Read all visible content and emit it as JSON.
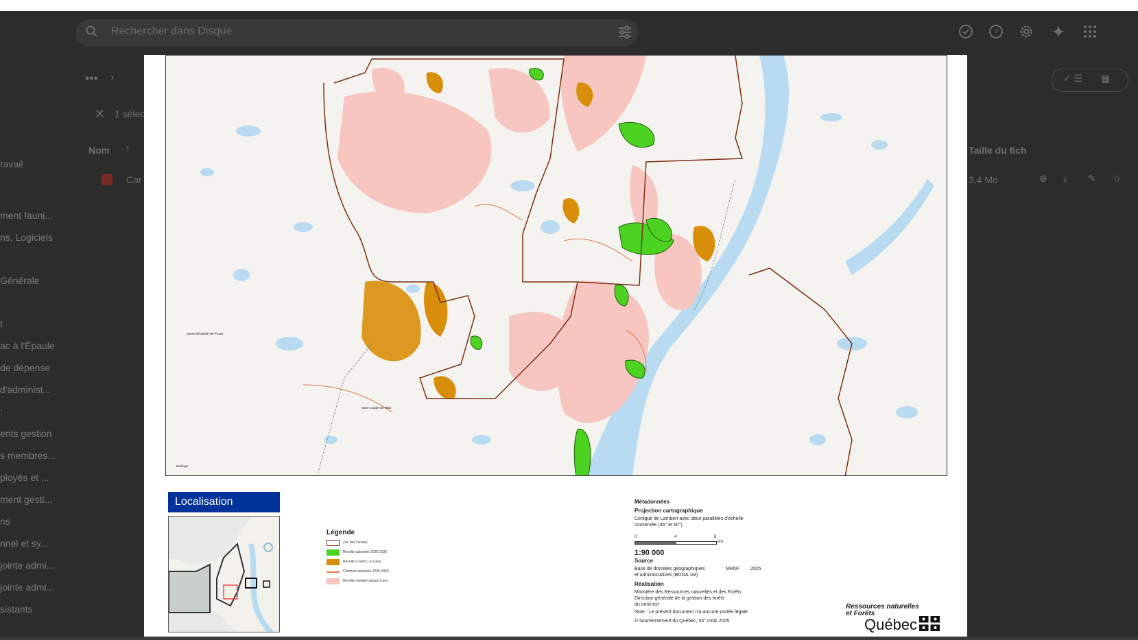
{
  "drive": {
    "search_placeholder": "Rechercher dans Disque",
    "selection_text": "1 sélec",
    "column_name": "Nom",
    "column_size": "Taille du fich",
    "file_name_fragment": "Car",
    "file_size": "3,4 Mo",
    "sidebar_items": [
      "ravail",
      "ment fauni...",
      "ns, Logiciels",
      "Générale",
      "t",
      "ac à l'Épaule",
      " de dépense",
      "d'administ...",
      ":",
      "ents gestion",
      "s membres...",
      "ployés et ...",
      "ment gesti...",
      "ns",
      "nnel et sy...",
      "jointe admi...",
      "jointe admi...",
      "sistants"
    ]
  },
  "map": {
    "place_labels": [
      "Sainte-Élisabeth-de-Proulx",
      "Saint-Ludger-de-Milot",
      "Budinger"
    ],
    "colors": {
      "zec_boundary": "#7b2e12",
      "harvest_authorized": "#4cd322",
      "harvest_upcoming": "#d98e0a",
      "roads": "#e07a4a",
      "harvest_recent": "#f7c6c0",
      "water": "#b9dbf1"
    }
  },
  "localisation": {
    "title": "Localisation"
  },
  "legend": {
    "title": "Légende",
    "items": [
      {
        "label": "Zec des Passes",
        "color": "#7b2e12",
        "kind": "outline"
      },
      {
        "label": "Récolte autorisée 2025-2026",
        "color": "#4cd322",
        "kind": "fill"
      },
      {
        "label": "Récolte à venir 1 à 2 ans",
        "color": "#d98e0a",
        "kind": "fill"
      },
      {
        "label": "Chemins autorisés 2025-2026",
        "color": "#e07a4a",
        "kind": "line"
      },
      {
        "label": "Récolte réalisée depuis 5 ans",
        "color": "#f7c6c0",
        "kind": "fill"
      }
    ]
  },
  "metadata": {
    "heading": "Métadonnées",
    "projection_title": "Projection cartographique",
    "projection_text_1": "Conique de Lambert avec deux parallèles d'échelle",
    "projection_text_2": "conservée (46° et 60°)",
    "scale_ticks": [
      "0",
      "4",
      "8"
    ],
    "scale_unit": "km",
    "scale": "1:90 000",
    "source_title": "Source",
    "source_text_1": "Base de données géographiques",
    "source_text_2": "et administratives (BDGA 1M)",
    "source_org": "MRNF",
    "source_year": "2025",
    "realisation_title": "Réalisation",
    "realisation_text_1": "Ministère des Ressources naturelles et des Forêts",
    "realisation_text_2": "Direction générale de la gestion des forêts",
    "realisation_text_3": "du nord-est",
    "note": "Note : Le présent document n'a aucune portée légale",
    "copyright": "© Gouvernement du Québec, 04° mois 2025"
  },
  "branding": {
    "ministry_line_1": "Ressources naturelles",
    "ministry_line_2": "et Forêts",
    "name": "Québec"
  }
}
